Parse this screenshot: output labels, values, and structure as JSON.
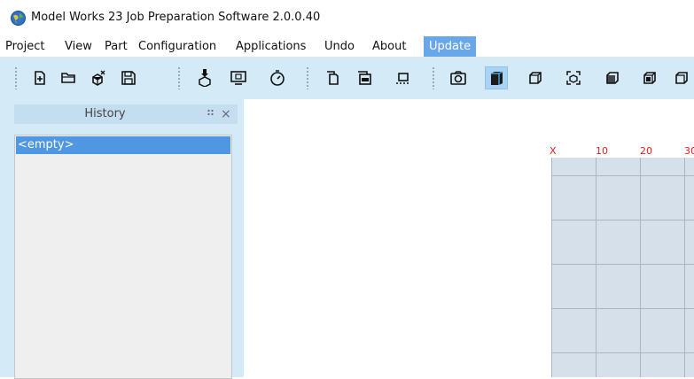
{
  "window": {
    "title": "Model Works 23 Job Preparation Software 2.0.0.40"
  },
  "menu": {
    "items": [
      "Project",
      "View",
      "Part",
      "Configuration",
      "Applications",
      "Undo",
      "About",
      "Update"
    ],
    "active": "Update"
  },
  "toolbar": {
    "buttons": [
      "new-file-icon",
      "open-folder-icon",
      "close-model-icon",
      "save-icon",
      "import-model-icon",
      "display-icon",
      "timer-icon",
      "copy-page-icon",
      "cad-icon",
      "frame-icon",
      "camera-icon",
      "view-solid-icon",
      "view-cube-icon",
      "view-sphere-icon",
      "view-front-icon",
      "view-side-icon",
      "view-top-icon"
    ],
    "active_button": "view-solid-icon"
  },
  "history_panel": {
    "title": "History",
    "items": [
      "<empty>"
    ]
  },
  "canvas": {
    "ruler_labels": [
      "X",
      "10",
      "20",
      "30"
    ]
  },
  "colors": {
    "toolbar_bg": "#d4ebf7",
    "menu_active": "#6aa7e8",
    "selection": "#4f97e0",
    "ruler_text": "#e02020",
    "grid_fill": "#d6e0ea"
  }
}
